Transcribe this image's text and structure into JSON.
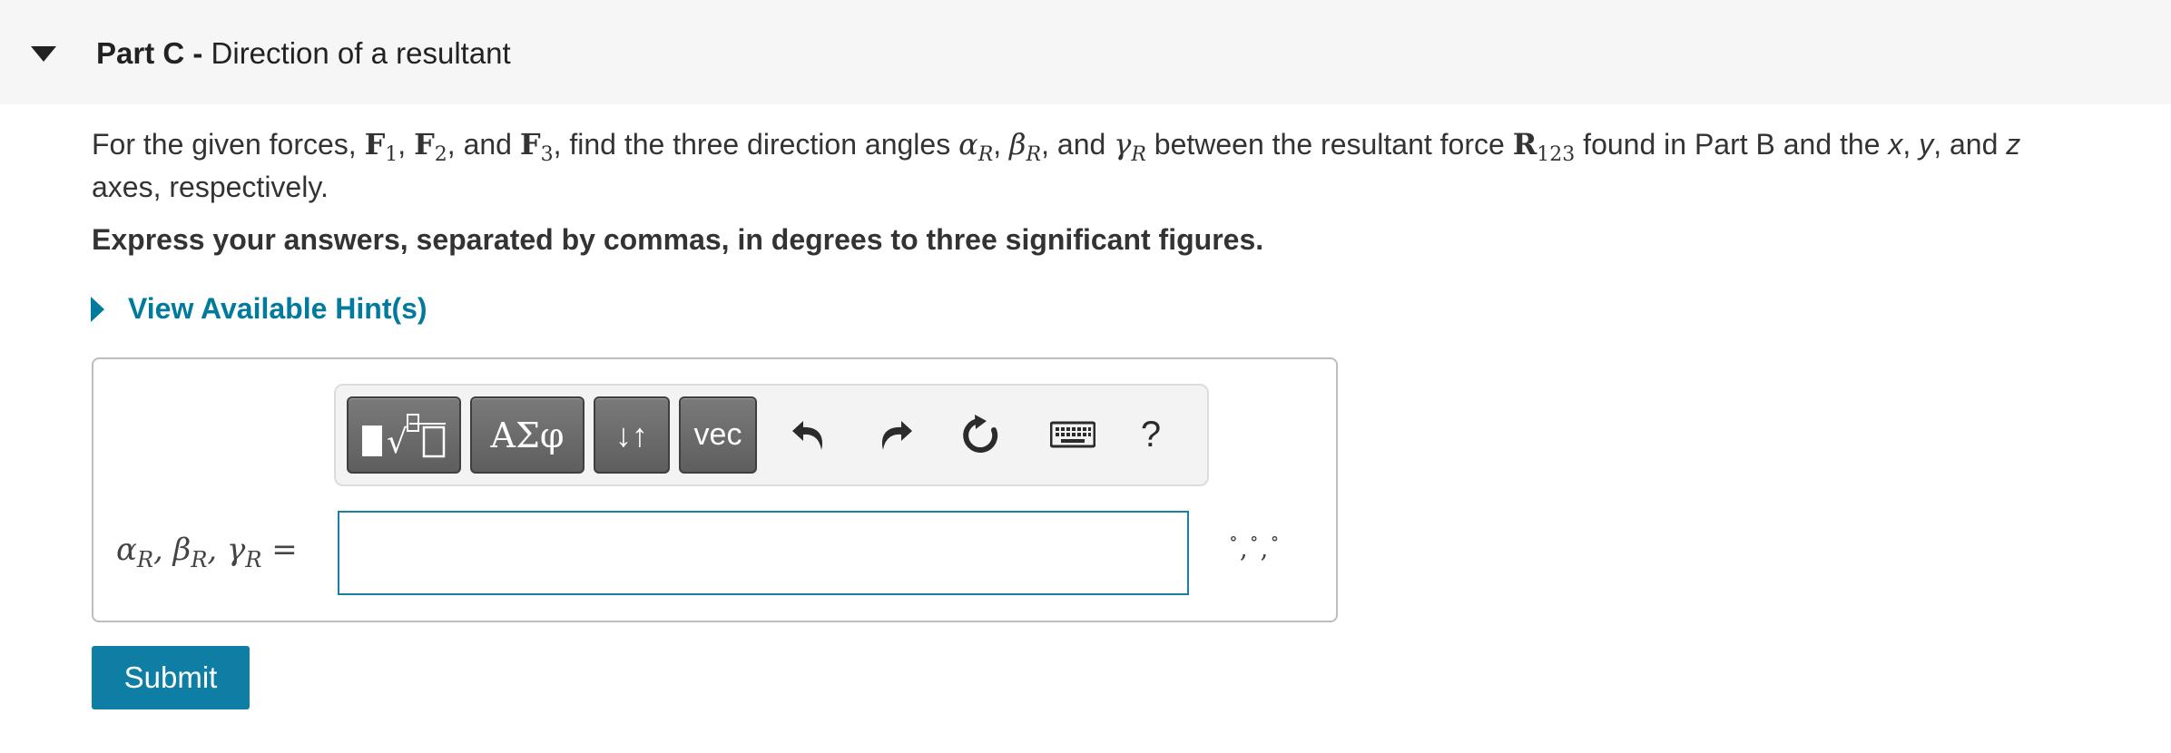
{
  "part": {
    "label": "Part C",
    "separator": " - ",
    "title": "Direction of a resultant"
  },
  "question": {
    "intro": "For the given forces, ",
    "f_symbol": "F",
    "f1_sub": "1",
    "f2_sub": "2",
    "f3_sub": "3",
    "comma": ", ",
    "and": ", and ",
    "find_text": ", find the three direction angles ",
    "alpha": "α",
    "beta": "β",
    "gamma": "γ",
    "r_sub": "R",
    "between_text": " between the resultant force ",
    "r_symbol": "R",
    "r123_sub": "123",
    "found_text": " found in Part B and the ",
    "x": "x",
    "y": "y",
    "z": "z",
    "and_text": ", and ",
    "end_text": "axes, respectively."
  },
  "instruction": "Express your answers, separated by commas, in degrees to three significant figures.",
  "hint": {
    "label": "View Available Hint(s)"
  },
  "toolbar": {
    "templates_icon": "templates-icon",
    "greek_label": "ΑΣφ",
    "arrows_label": "↓↑",
    "vec_label": "vec",
    "undo_icon": "undo-icon",
    "redo_icon": "redo-icon",
    "reset_icon": "reset-icon",
    "keyboard_icon": "keyboard-icon",
    "help_label": "?"
  },
  "answer": {
    "lhs_alpha": "α",
    "lhs_beta": "β",
    "lhs_gamma": "γ",
    "lhs_sub": "R",
    "lhs_sep": ", ",
    "lhs_eq": " =",
    "value": "",
    "units_deg": "∘",
    "units_sep": ","
  },
  "submit_label": "Submit",
  "colors": {
    "accent": "#007b9e",
    "submit_bg": "#0e7ea4",
    "input_border": "#1a7fa0",
    "header_bg": "#f6f6f6"
  }
}
